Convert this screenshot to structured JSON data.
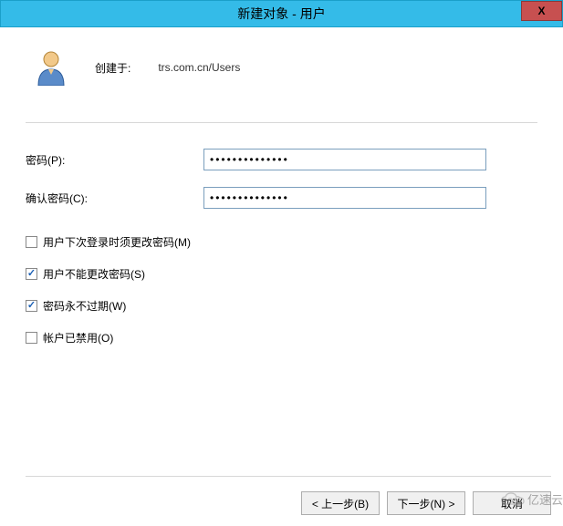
{
  "titlebar": {
    "title": "新建对象 - 用户",
    "close": "X"
  },
  "header": {
    "created_in_label": "创建于:",
    "created_in_path": "trs.com.cn/Users"
  },
  "fields": {
    "password_label": "密码(P):",
    "password_value": "●●●●●●●●●●●●●●",
    "confirm_label": "确认密码(C):",
    "confirm_value": "●●●●●●●●●●●●●●"
  },
  "checkboxes": {
    "must_change": {
      "label": "用户下次登录时须更改密码(M)",
      "checked": false
    },
    "cannot_change": {
      "label": "用户不能更改密码(S)",
      "checked": true
    },
    "never_expires": {
      "label": "密码永不过期(W)",
      "checked": true
    },
    "disabled": {
      "label": "帐户已禁用(O)",
      "checked": false
    }
  },
  "buttons": {
    "back": "< 上一步(B)",
    "next": "下一步(N) >",
    "cancel": "取消"
  },
  "watermark": {
    "text": "亿速云"
  }
}
